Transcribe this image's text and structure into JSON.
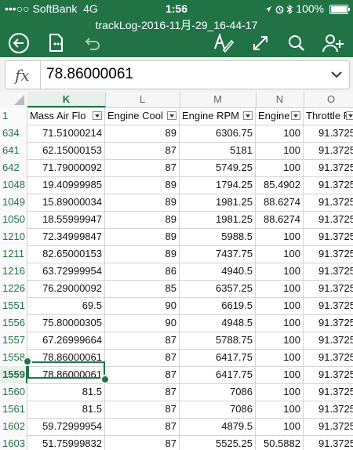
{
  "status_bar": {
    "carrier": "•••○○ SoftBank",
    "network": "4G",
    "time": "1:56",
    "icons": [
      "location-icon",
      "alarm-icon",
      "bluetooth-icon"
    ],
    "battery_text": "100%",
    "battery_level": 1.0
  },
  "document": {
    "title": "trackLog-2016-11月-29_16-44-17"
  },
  "toolbar": {
    "left": [
      "back-icon",
      "save-icon",
      "undo-icon"
    ],
    "right": [
      "format-icon",
      "expand-icon",
      "search-icon",
      "share-icon"
    ]
  },
  "formula_bar": {
    "fx_label": "fx",
    "value": "78.86000061"
  },
  "colors": {
    "accent": "#217346"
  },
  "grid": {
    "selected_cell": "K1559",
    "column_letters": [
      "K",
      "L",
      "M",
      "N",
      "O"
    ],
    "headers": [
      "Mass Air Flo",
      "Engine Cool",
      "Engine RPM",
      "Engine",
      "Throttle Po"
    ],
    "header_row_number": "1",
    "rows": [
      {
        "num": "634",
        "cells": [
          "71.51000214",
          "89",
          "6306.75",
          "100",
          "91.3725"
        ]
      },
      {
        "num": "641",
        "cells": [
          "62.15000153",
          "87",
          "5181",
          "100",
          "91.3725"
        ]
      },
      {
        "num": "642",
        "cells": [
          "71.79000092",
          "87",
          "5749.25",
          "100",
          "91.3725"
        ]
      },
      {
        "num": "1048",
        "cells": [
          "19.40999985",
          "89",
          "1794.25",
          "85.4902",
          "91.3725"
        ]
      },
      {
        "num": "1049",
        "cells": [
          "15.89000034",
          "89",
          "1981.25",
          "88.6274",
          "91.3725"
        ]
      },
      {
        "num": "1050",
        "cells": [
          "18.55999947",
          "89",
          "1981.25",
          "88.6274",
          "91.3725"
        ]
      },
      {
        "num": "1210",
        "cells": [
          "72.34999847",
          "89",
          "5988.5",
          "100",
          "91.3725"
        ]
      },
      {
        "num": "1211",
        "cells": [
          "82.65000153",
          "89",
          "7437.75",
          "100",
          "91.3725"
        ]
      },
      {
        "num": "1216",
        "cells": [
          "63.72999954",
          "86",
          "4940.5",
          "100",
          "91.3725"
        ]
      },
      {
        "num": "1226",
        "cells": [
          "76.29000092",
          "85",
          "6357.25",
          "100",
          "91.3725"
        ]
      },
      {
        "num": "1551",
        "cells": [
          "69.5",
          "90",
          "6619.5",
          "100",
          "91.3725"
        ]
      },
      {
        "num": "1556",
        "cells": [
          "75.80000305",
          "90",
          "4948.5",
          "100",
          "91.3725"
        ]
      },
      {
        "num": "1557",
        "cells": [
          "67.26999664",
          "87",
          "5788.75",
          "100",
          "91.3725"
        ]
      },
      {
        "num": "1558",
        "cells": [
          "78.86000061",
          "87",
          "6417.75",
          "100",
          "91.3725"
        ]
      },
      {
        "num": "1559",
        "cells": [
          "78.86000061",
          "87",
          "6417.75",
          "100",
          "91.3725"
        ]
      },
      {
        "num": "1560",
        "cells": [
          "81.5",
          "87",
          "7086",
          "100",
          "91.3725"
        ]
      },
      {
        "num": "1561",
        "cells": [
          "81.5",
          "87",
          "7086",
          "100",
          "91.3725"
        ]
      },
      {
        "num": "1602",
        "cells": [
          "59.72999954",
          "87",
          "4879.5",
          "100",
          "91.3725"
        ]
      },
      {
        "num": "1603",
        "cells": [
          "51.75999832",
          "87",
          "5525.25",
          "50.5882",
          "91.3725"
        ]
      }
    ]
  }
}
